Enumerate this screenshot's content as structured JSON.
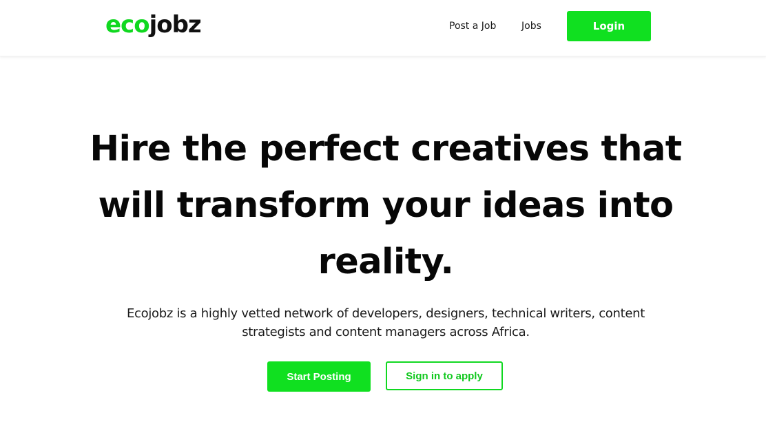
{
  "brand": {
    "logo_part1": "eco",
    "logo_part2": "jobz",
    "accent_color": "#10e020"
  },
  "nav": {
    "post_job": "Post a Job",
    "jobs": "Jobs",
    "login": "Login"
  },
  "hero": {
    "title": "Hire the perfect creatives that will transform your ideas into reality.",
    "subtitle": "Ecojobz is a highly vetted network of developers, designers, technical writers, content strategists and content managers across Africa.",
    "primary_cta": "Start Posting",
    "secondary_cta": "Sign in to apply"
  }
}
